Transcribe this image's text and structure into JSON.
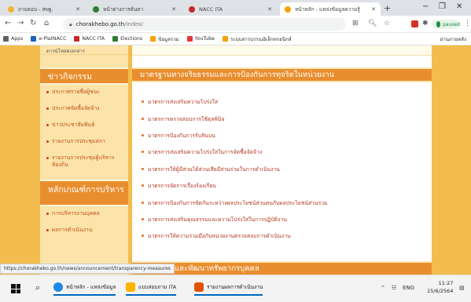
{
  "browser": {
    "tabs": [
      {
        "title": "ถามตอบ - สพฐ.",
        "color": "#f2b233"
      },
      {
        "title": "หน้าต่างการค้นหา",
        "color": "#2e7d32"
      },
      {
        "title": "NACC ITA",
        "color": "#c62828"
      },
      {
        "title": "หน้าหลัก - แหล่งข้อมูลความรู้",
        "color": "#f4a100"
      }
    ],
    "new_tab": "+",
    "window": {
      "minimize": "−",
      "restore": "❐",
      "close": "✕"
    },
    "address": {
      "host": "chorakhebo.go.th",
      "path": "/index/"
    },
    "profile_label": "paused"
  },
  "bookmarks": {
    "items": [
      {
        "label": "Apps",
        "color": "#5f6368"
      },
      {
        "label": "e-PlatNACC",
        "color": "#1565c0"
      },
      {
        "label": "NACC ITA",
        "color": "#c62828"
      },
      {
        "label": "Elections",
        "color": "#2e7d32"
      },
      {
        "label": "ข้อมูลรวม",
        "color": "#f4a100"
      },
      {
        "label": "YouTube",
        "color": "#e53935"
      },
      {
        "label": "ระบบสารบรรณอิเล็กทรอนิกส์",
        "color": "#f4a100"
      }
    ],
    "reading_list": "อ่านภายหลัง"
  },
  "sidebar": {
    "top_text": "ดาวน์โหลดเอกสาร",
    "news_heading": "ข่าวกิจกรรม",
    "news_items": [
      "ประกาศรายชื่อผู้ชนะ",
      "ประกาศจัดซื้อจัดจ้าง",
      "ข่าวประชาสัมพันธ์",
      "รายงานการประชุมสภา",
      "รายงานการประชุมผู้บริหารท้องถิ่น"
    ],
    "services_heading": "หลักเกณฑ์การบริหาร",
    "service_items": [
      "การบริหารงานบุคคล",
      "ผลการดำเนินงาน"
    ]
  },
  "main": {
    "section_heading": "มาตรฐานทางจริยธรรมและการป้องกันการทุจริตในหน่วยงาน",
    "links": [
      "มาตรการส่งเสริมความโปร่งใส",
      "มาตรการตรวจสอบการใช้ดุลพินิจ",
      "มาตรการป้องกันการรับสินบน",
      "มาตรการส่งเสริมความโปร่งใสในการจัดซื้อจัดจ้าง",
      "มาตรการให้ผู้มีส่วนได้ส่วนเสียมีส่วนร่วมในการดำเนินงาน",
      "มาตรการจัดการเรื่องร้องเรียน",
      "มาตรการป้องกันการขัดกันระหว่างผลประโยชน์ส่วนตนกับผลประโยชน์ส่วนรวม",
      "มาตรการส่งเสริมคุณธรรมและความโปร่งใสในการปฏิบัติงาน",
      "มาตรการให้ความร่วมมือกับหน่วยงานตรวจสอบการดำเนินงาน"
    ],
    "bottom_heading": "การบริหารและพัฒนาทรัพยากรบุคคล"
  },
  "status_url": "https://chorakhebo.go.th/news/announcement/transparency-measures",
  "taskbar": {
    "apps": [
      {
        "label": "หน้าหลัก - แหล่งข้อมูล",
        "color": "#1e88e5"
      },
      {
        "label": "แบบสอบถาม ITA",
        "color": "#ffb300"
      },
      {
        "label": "รายงานผลการดำเนินงาน",
        "color": "#e65100"
      }
    ],
    "tray": "ENG",
    "time": "11:27",
    "date": "15/6/2564"
  }
}
